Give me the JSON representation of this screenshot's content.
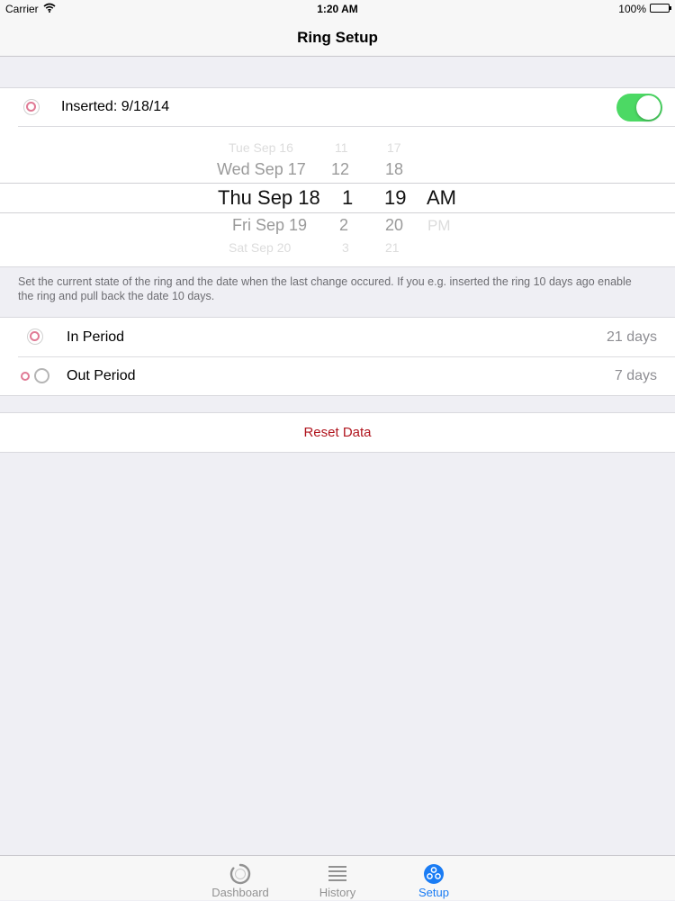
{
  "status_bar": {
    "carrier": "Carrier",
    "time": "1:20 AM",
    "battery": "100%"
  },
  "nav": {
    "title": "Ring Setup"
  },
  "inserted_row": {
    "label": "Inserted: 9/18/14",
    "toggle_on": true
  },
  "picker": {
    "rows": [
      {
        "date": "Tue Sep 16",
        "hour": "11",
        "minute": "17",
        "ampm": ""
      },
      {
        "date": "Wed Sep 17",
        "hour": "12",
        "minute": "18",
        "ampm": ""
      },
      {
        "date": "Thu Sep 18",
        "hour": "1",
        "minute": "19",
        "ampm": "AM"
      },
      {
        "date": "Fri Sep 19",
        "hour": "2",
        "minute": "20",
        "ampm": "PM"
      },
      {
        "date": "Sat Sep 20",
        "hour": "3",
        "minute": "21",
        "ampm": ""
      }
    ]
  },
  "description": "Set the current state of the ring and the date when the last change occured. If you e.g. inserted the ring 10 days ago enable the ring and pull back the date 10 days.",
  "periods": [
    {
      "label": "In Period",
      "value": "21 days",
      "icon": "ring-in-icon"
    },
    {
      "label": "Out Period",
      "value": "7 days",
      "icon": "ring-out-icon"
    }
  ],
  "reset_label": "Reset Data",
  "colors": {
    "accent": "#1a7cf4",
    "toggle_on": "#4cd964",
    "ring": "#e07a95",
    "destructive": "#b0151e"
  },
  "tabs": [
    {
      "label": "Dashboard",
      "icon": "dashboard-icon",
      "active": false
    },
    {
      "label": "History",
      "icon": "history-icon",
      "active": false
    },
    {
      "label": "Setup",
      "icon": "setup-icon",
      "active": true
    }
  ]
}
